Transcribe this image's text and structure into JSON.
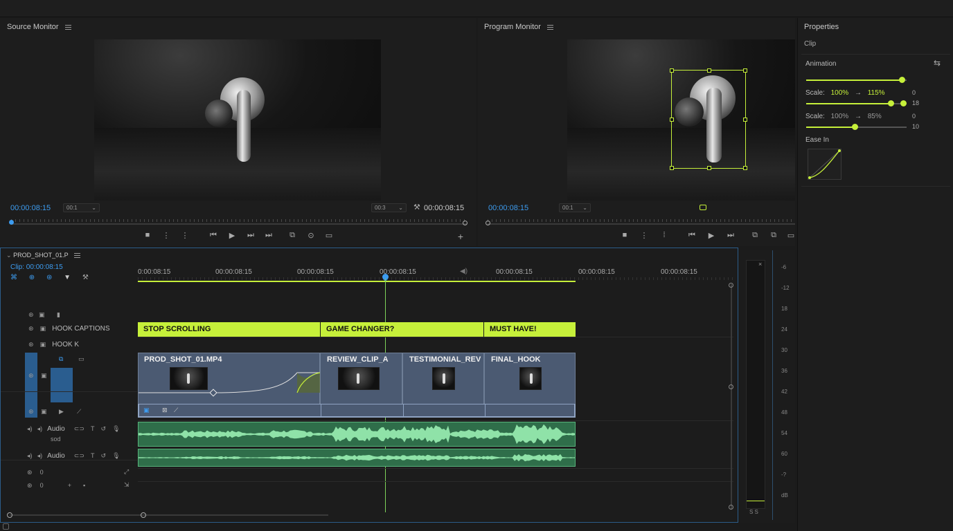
{
  "source_monitor": {
    "title": "Source Monitor",
    "timecode_left": "00:00:08:15",
    "zoom_select": "00:1",
    "res_select": "00:3",
    "timecode_right": "00:00:08:15"
  },
  "program_monitor": {
    "title": "Program Monitor",
    "timecode_left": "00:00:08:15",
    "zoom_select": "00:1"
  },
  "properties": {
    "title": "Properties",
    "section_clip": "Clip",
    "animation_label": "Animation",
    "scale1_label": "Scale:",
    "scale1_from": "100%",
    "scale1_arrow": "→",
    "scale1_to": "115%",
    "scale1_val_a": "0",
    "scale1_val_b": "18",
    "scale2_label": "Scale:",
    "scale2_from": "100%",
    "scale2_arrow": "→",
    "scale2_to": "85%",
    "scale2_val_a": "0",
    "scale2_val_b": "10",
    "ease_label": "Ease In",
    "slider_levels": [
      0.95,
      0.84,
      0.48
    ]
  },
  "timeline": {
    "sequence_name": "PROD_SHOT_01.P",
    "clip_timecode": "00:00:08:15",
    "clip_label": "Clip:",
    "ruler": [
      "0:00:08:15",
      "00:00:08:15",
      "00:00:08:15",
      "00:00:08:15",
      "00:00:08:15",
      "00:00:08:15",
      "00:00:08:15"
    ],
    "tracks": {
      "captions": "HOOK CAPTIONS",
      "hook": "HOOK K",
      "audio1_name": "Audio",
      "audio1_sub": "sod",
      "audio2_name": "Audio",
      "zero_a": "0",
      "zero_b": "0"
    },
    "caption_clips": [
      "STOP SCROLLING",
      "GAME CHANGER?",
      "MUST HAVE!"
    ],
    "video_clips": [
      "PROD_SHOT_01.MP4",
      "REVIEW_CLIP_A",
      "TESTIMONIAL_REV",
      "FINAL_HOOK"
    ]
  },
  "meters": {
    "scale": [
      "-6",
      "-12",
      "18",
      "24",
      "30",
      "36",
      "42",
      "48",
      "54",
      "60",
      "-?",
      "dB"
    ],
    "bottom": "S S"
  },
  "colors": {
    "accent_green": "#c6f03a",
    "timecode_blue": "#3d9cf0",
    "video_clip": "#4b5a72",
    "audio_clip": "#2f6e4a"
  }
}
